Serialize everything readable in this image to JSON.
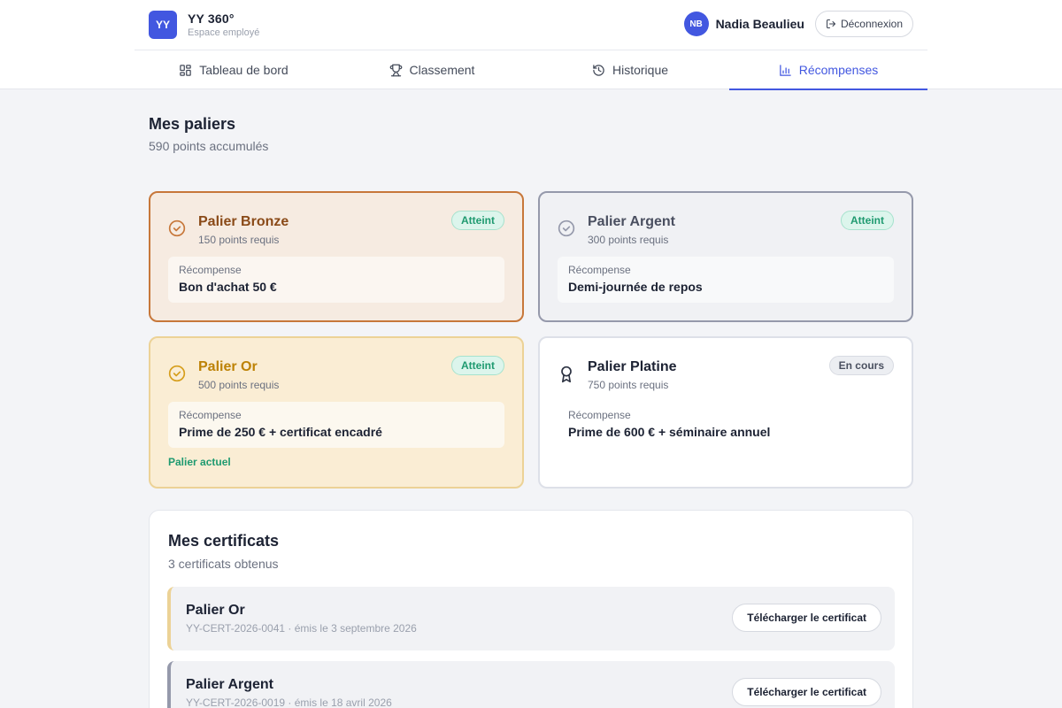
{
  "brand": {
    "logo": "YY",
    "name": "YY 360°",
    "subtitle": "Espace employé"
  },
  "user": {
    "initials": "NB",
    "name": "Nadia Beaulieu",
    "logout_label": "Déconnexion"
  },
  "tabs": [
    {
      "label": "Tableau de bord",
      "icon": "dashboard-icon",
      "active": false
    },
    {
      "label": "Classement",
      "icon": "trophy-icon",
      "active": false
    },
    {
      "label": "Historique",
      "icon": "history-icon",
      "active": false
    },
    {
      "label": "Récompenses",
      "icon": "bar-chart-icon",
      "active": true
    }
  ],
  "paliers": {
    "title": "Mes paliers",
    "subtitle": "590 points accumulés",
    "reward_label": "Récompense",
    "current_label": "Palier actuel",
    "tiers": [
      {
        "name": "Palier Bronze",
        "required": "150 points requis",
        "status": "Atteint",
        "reward": "Bon d'achat 50 €",
        "color": "#c7773a"
      },
      {
        "name": "Palier Argent",
        "required": "300 points requis",
        "status": "Atteint",
        "reward": "Demi-journée de repos",
        "color": "#9599ab"
      },
      {
        "name": "Palier Or",
        "required": "500 points requis",
        "status": "Atteint",
        "reward": "Prime de 250 € + certificat encadré",
        "color": "#bd8205",
        "current": true
      },
      {
        "name": "Palier Platine",
        "required": "750 points requis",
        "status": "En cours",
        "reward": "Prime de 600 € + séminaire annuel",
        "color": "#1c2233"
      }
    ]
  },
  "certificats": {
    "title": "Mes certificats",
    "subtitle": "3 certificats obtenus",
    "download_label": "Télécharger le certificat",
    "items": [
      {
        "title": "Palier Or",
        "meta": "YY-CERT-2026-0041 · émis le 3 septembre 2026"
      },
      {
        "title": "Palier Argent",
        "meta": "YY-CERT-2026-0019 · émis le 18 avril 2026"
      }
    ]
  },
  "colors": {
    "accent": "#4257e0",
    "success": "#1f9a70"
  }
}
